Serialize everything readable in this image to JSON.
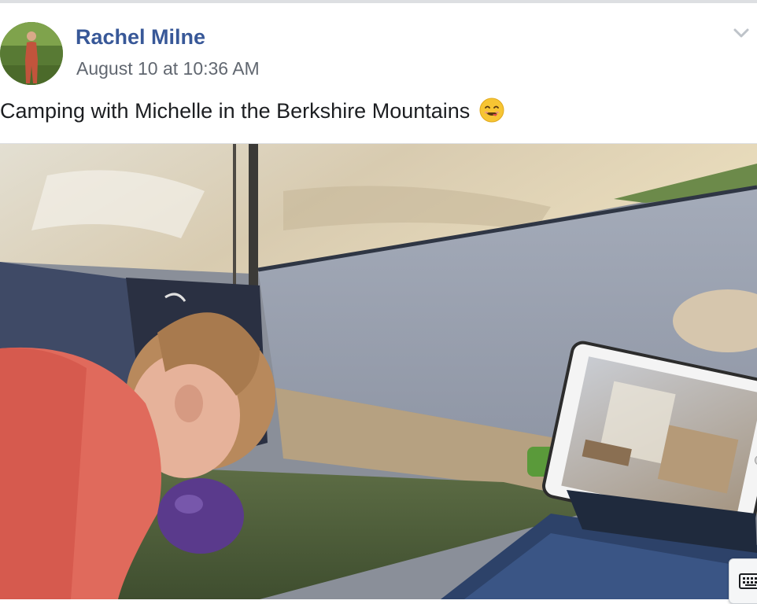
{
  "post": {
    "author_name": "Rachel Milne",
    "timestamp": "August 10 at 10:36 AM",
    "caption_text": "Camping with Michelle in the Berkshire Mountains",
    "caption_emoji": "smiling-face-savoring-food-icon"
  },
  "icons": {
    "options": "chevron-down-icon",
    "keyboard": "keyboard-icon"
  },
  "colors": {
    "name_link": "#385898",
    "timestamp": "#616770",
    "text": "#1c1e21",
    "divider": "#dddfe2"
  }
}
